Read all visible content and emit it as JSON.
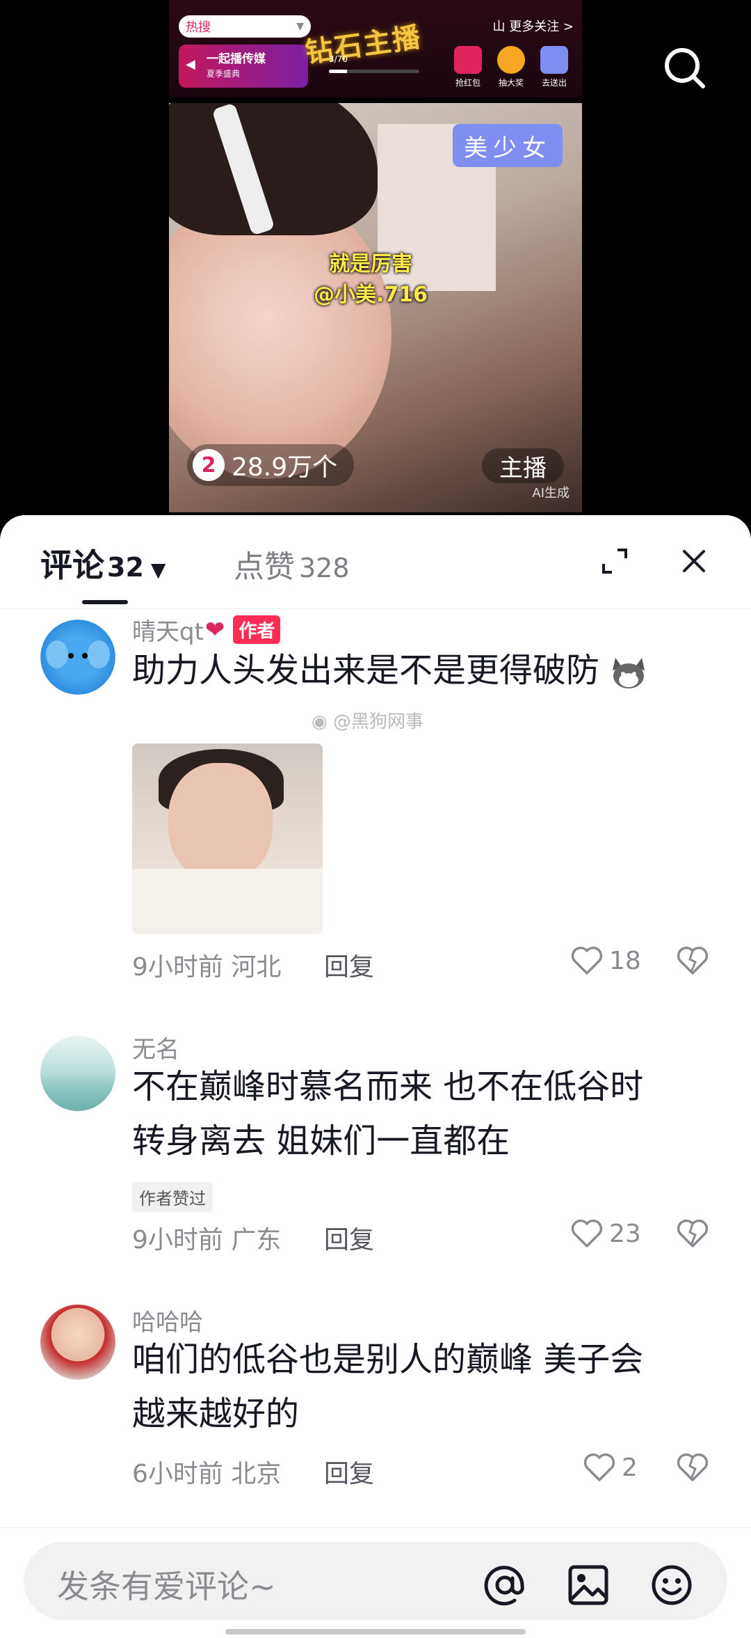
{
  "live_banner": {
    "hot_label": "热搜",
    "event_title": "一起播传媒",
    "event_subtitle": "夏季盛典",
    "banner_title": "钻石主播",
    "progress_text": "3/70",
    "progress_fraction": 0.2,
    "follow_more": "山 更多关注 >",
    "tasks": [
      {
        "label": "抢红包",
        "color": "#e0245e"
      },
      {
        "label": "抽大奖",
        "color": "#f5a623"
      },
      {
        "label": "去送出",
        "color": "#7f8ef0"
      }
    ]
  },
  "video": {
    "badge": "美少女",
    "caption_line1": "就是厉害",
    "caption_line2": "@小美.716",
    "rank_number": "2",
    "viewers": "28.9万个",
    "anchor_label": "主播",
    "ai_label": "AI生成"
  },
  "tabs": {
    "comments_label": "评论",
    "comments_count": "32",
    "likes_label": "点赞",
    "likes_count": "328"
  },
  "comments": [
    {
      "username": "晴天qt",
      "author_tag": "作者",
      "text": "助力人头发出来是不是更得破防",
      "time_location": "9小时前 河北",
      "reply_label": "回复",
      "likes": "18"
    },
    {
      "username": "无名",
      "text_line1": "不在巅峰时慕名而来 也不在低谷时",
      "text_line2": "转身离去 姐妹们一直都在",
      "liked_badge": "作者赞过",
      "time_location": "9小时前 广东",
      "reply_label": "回复",
      "likes": "23"
    },
    {
      "username": "哈哈哈",
      "text_line1": "咱们的低谷也是别人的巅峰 美子会",
      "text_line2": "越来越好的",
      "time_location": "6小时前 北京",
      "reply_label": "回复",
      "likes": "2"
    }
  ],
  "watermark": "@黑狗网事",
  "input": {
    "placeholder": "发条有爱评论~"
  },
  "colors": {
    "accent": "#fe2c55",
    "text_primary": "#161823",
    "text_secondary": "#8a8b91"
  }
}
